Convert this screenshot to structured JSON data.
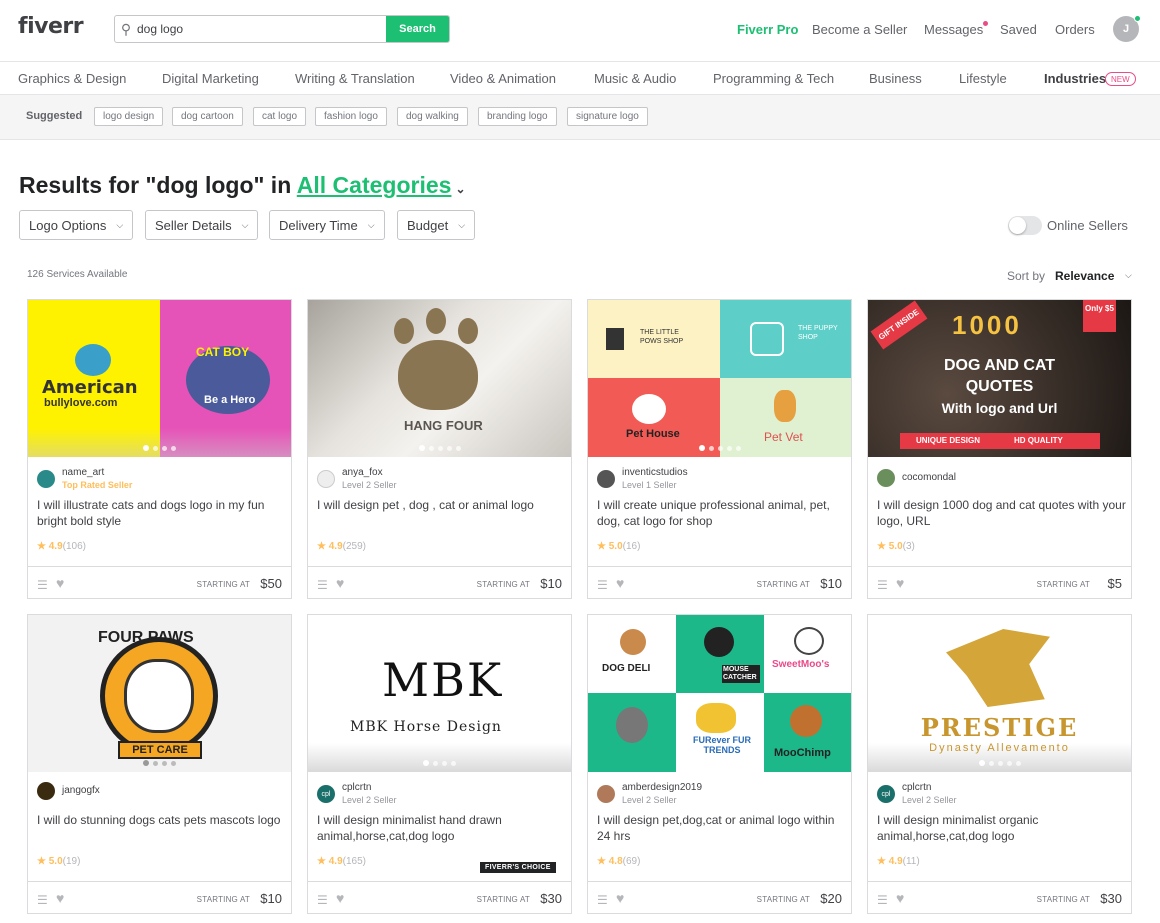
{
  "header": {
    "logo": "fiverr",
    "search_value": "dog logo",
    "search_button": "Search",
    "nav": {
      "pro": "Fiverr Pro",
      "become_seller": "Become a Seller",
      "messages": "Messages",
      "saved": "Saved",
      "orders": "Orders"
    },
    "avatar_letter": "J"
  },
  "categories": [
    "Graphics & Design",
    "Digital Marketing",
    "Writing & Translation",
    "Video & Animation",
    "Music & Audio",
    "Programming & Tech",
    "Business",
    "Lifestyle",
    "Industries"
  ],
  "new_badge": "NEW",
  "suggested": {
    "label": "Suggested",
    "chips": [
      "logo design",
      "dog cartoon",
      "cat logo",
      "fashion logo",
      "dog walking",
      "branding logo",
      "signature logo"
    ]
  },
  "results": {
    "prefix": "Results for \"dog logo\" in ",
    "category": "All Categories"
  },
  "filters": [
    "Logo Options",
    "Seller Details",
    "Delivery Time",
    "Budget"
  ],
  "online_sellers": "Online Sellers",
  "count": "126 Services Available",
  "sort": {
    "label": "Sort by",
    "value": "Relevance"
  },
  "start_label": "STARTING AT",
  "fiverrs_choice": "FIVERR'S CHOICE",
  "gigs": [
    {
      "seller": "name_art",
      "level": "Top Rated Seller",
      "title": "I will illustrate cats and dogs logo in my fun bright bold style",
      "rating": "4.9",
      "reviews": "(106)",
      "price": "$50",
      "img_text": [
        "American",
        "bullylove.com",
        "CAT BOY",
        "Be a Hero"
      ]
    },
    {
      "seller": "anya_fox",
      "level": "Level 2 Seller",
      "title": "I will design pet , dog , cat or animal logo",
      "rating": "4.9",
      "reviews": "(259)",
      "price": "$10",
      "img_text": [
        "HANG FOUR"
      ]
    },
    {
      "seller": "inventicstudios",
      "level": "Level 1 Seller",
      "title": "I will create unique professional animal, pet, dog, cat logo for shop",
      "rating": "5.0",
      "reviews": "(16)",
      "price": "$10",
      "img_text": [
        "THE LITTLE POWS SHOP",
        "THE PUPPY SHOP",
        "Pet House",
        "Pet Vet"
      ]
    },
    {
      "seller": "cocomondal",
      "level": "",
      "title": "I will design 1000 dog and cat quotes with your logo, URL",
      "rating": "5.0",
      "reviews": "(3)",
      "price": "$5",
      "img_text": [
        "1000",
        "DOG AND CAT",
        "QUOTES",
        "With logo and Url",
        "GIFT INSIDE",
        "Only $5",
        "UNIQUE DESIGN",
        "HD QUALITY"
      ]
    },
    {
      "seller": "jangogfx",
      "level": "",
      "title": "I will do stunning dogs cats pets mascots logo",
      "rating": "5.0",
      "reviews": "(19)",
      "price": "$10",
      "img_text": [
        "FOUR PAWS",
        "PET CARE"
      ]
    },
    {
      "seller": "cplcrtn",
      "level": "Level 2 Seller",
      "title": "I will design minimalist hand drawn animal,horse,cat,dog logo",
      "rating": "4.9",
      "reviews": "(165)",
      "price": "$30",
      "img_text": [
        "MBK",
        "MBK Horse Design"
      ]
    },
    {
      "seller": "amberdesign2019",
      "level": "Level 2 Seller",
      "title": "I will design pet,dog,cat or animal logo within 24 hrs",
      "rating": "4.8",
      "reviews": "(69)",
      "price": "$20",
      "img_text": [
        "DOG DELI",
        "MOUSE CATCHER",
        "SweetMoo's",
        "FURever FUR TRENDS",
        "MooChimp"
      ]
    },
    {
      "seller": "cplcrtn",
      "level": "Level 2 Seller",
      "title": "I will design minimalist organic animal,horse,cat,dog logo",
      "rating": "4.9",
      "reviews": "(11)",
      "price": "$30",
      "img_text": [
        "PRESTIGE",
        "Dynasty Allevamento"
      ]
    }
  ],
  "colors": {
    "brand": "#1dbf73",
    "star": "#ffbe5b",
    "badge_pink": "#ea4c89"
  }
}
